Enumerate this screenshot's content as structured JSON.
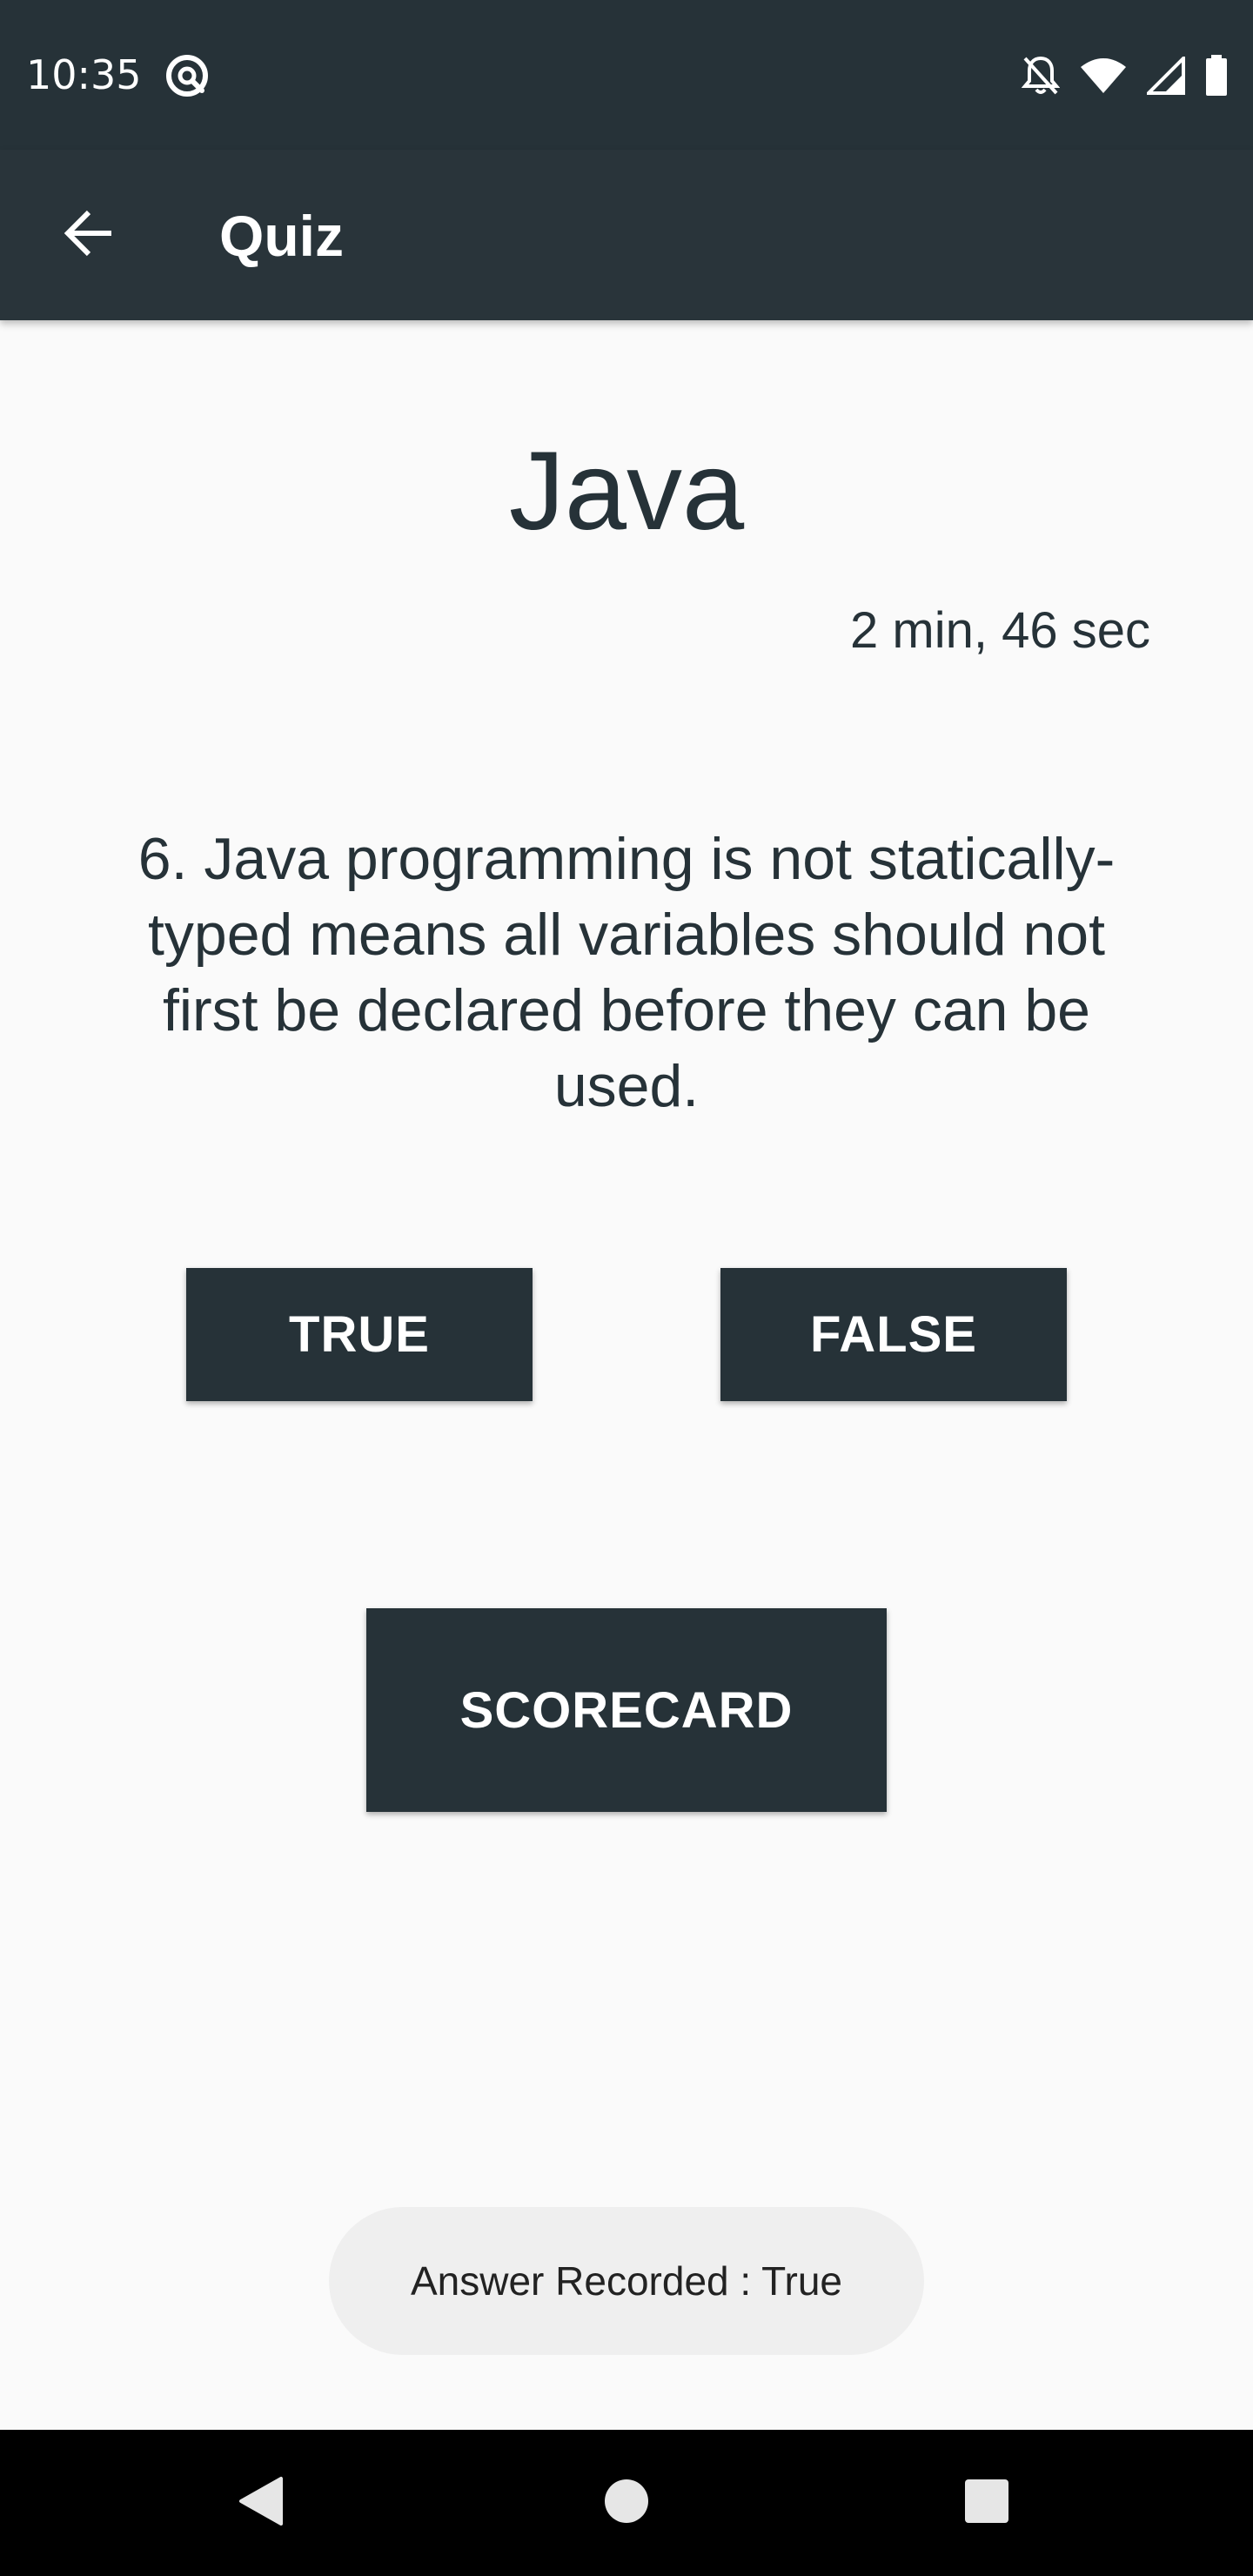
{
  "status_bar": {
    "time": "10:35",
    "icons": [
      "sync-indicator-icon",
      "notifications-off-icon",
      "wifi-icon",
      "signal-icon",
      "battery-icon"
    ]
  },
  "app_bar": {
    "title": "Quiz",
    "back_icon": "arrow-left-icon"
  },
  "quiz": {
    "title": "Java",
    "timer": "2 min, 46 sec",
    "question": "6. Java programming is not statically-typed means all variables should not first be declared before they can be used.",
    "true_label": "TRUE",
    "false_label": "FALSE",
    "scorecard_label": "SCORECARD"
  },
  "toast": {
    "message": "Answer Recorded : True"
  },
  "nav_bar": {
    "icons": [
      "back-triangle-icon",
      "home-circle-icon",
      "recents-square-icon"
    ]
  },
  "colors": {
    "primary_dark": "#263238",
    "app_bar": "#29343a",
    "background": "#fafafa",
    "toast_bg": "#efefef"
  }
}
